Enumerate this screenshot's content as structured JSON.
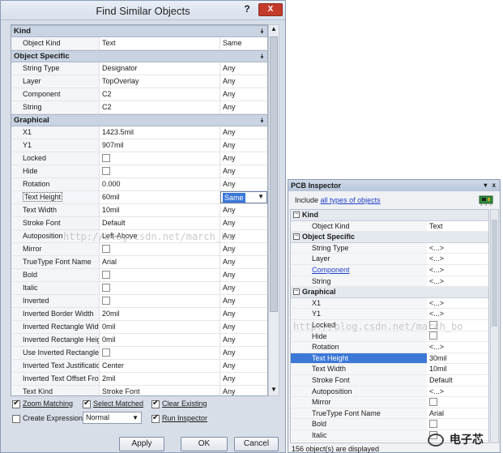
{
  "dialog": {
    "title": "Find Similar Objects",
    "help_glyph": "?",
    "close_glyph": "X",
    "categories": {
      "kind": "Kind",
      "object_specific": "Object Specific",
      "graphical": "Graphical"
    },
    "kind_rows": [
      {
        "label": "Object Kind",
        "value": "Text",
        "match": "Same"
      }
    ],
    "object_rows": [
      {
        "label": "String Type",
        "value": "Designator",
        "match": "Any"
      },
      {
        "label": "Layer",
        "value": "TopOverlay",
        "match": "Any"
      },
      {
        "label": "Component",
        "value": "C2",
        "match": "Any"
      },
      {
        "label": "String",
        "value": "C2",
        "match": "Any"
      }
    ],
    "graphical_rows": [
      {
        "label": "X1",
        "value": "1423.5mil",
        "match": "Any"
      },
      {
        "label": "Y1",
        "value": "907mil",
        "match": "Any"
      },
      {
        "label": "Locked",
        "value": "",
        "match": "Any",
        "checkbox": true
      },
      {
        "label": "Hide",
        "value": "",
        "match": "Any",
        "checkbox": true
      },
      {
        "label": "Rotation",
        "value": "0.000",
        "match": "Any"
      },
      {
        "label": "Text Height",
        "value": "60mil",
        "match": "Same",
        "selected": true
      },
      {
        "label": "Text Width",
        "value": "10mil",
        "match": "Any"
      },
      {
        "label": "Stroke Font",
        "value": "Default",
        "match": "Any"
      },
      {
        "label": "Autoposition",
        "value": "Left-Above",
        "match": "Any"
      },
      {
        "label": "Mirror",
        "value": "",
        "match": "Any",
        "checkbox": true
      },
      {
        "label": "TrueType Font Name",
        "value": "Arial",
        "match": "Any"
      },
      {
        "label": "Bold",
        "value": "",
        "match": "Any",
        "checkbox": true
      },
      {
        "label": "Italic",
        "value": "",
        "match": "Any",
        "checkbox": true
      },
      {
        "label": "Inverted",
        "value": "",
        "match": "Any",
        "checkbox": true
      },
      {
        "label": "Inverted Border Width",
        "value": "20mil",
        "match": "Any"
      },
      {
        "label": "Inverted Rectangle Widt",
        "value": "0mil",
        "match": "Any"
      },
      {
        "label": "Inverted Rectangle Heig",
        "value": "0mil",
        "match": "Any"
      },
      {
        "label": "Use Inverted Rectangle",
        "value": "",
        "match": "Any",
        "checkbox": true
      },
      {
        "label": "Inverted Text Justificatio",
        "value": "Center",
        "match": "Any"
      },
      {
        "label": "Inverted Text Offset Fror",
        "value": "2mil",
        "match": "Any"
      },
      {
        "label": "Text Kind",
        "value": "Stroke Font",
        "match": "Any"
      }
    ],
    "options": {
      "zoom_matching": {
        "label": "Zoom Matching",
        "checked": true
      },
      "select_matched": {
        "label": "Select Matched",
        "checked": true
      },
      "clear_existing": {
        "label": "Clear Existing",
        "checked": true
      },
      "create_expression": {
        "label": "Create Expression",
        "checked": false
      },
      "mode_value": "Normal",
      "run_inspector": {
        "label": "Run Inspector",
        "checked": true
      }
    },
    "buttons": {
      "apply": "Apply",
      "ok": "OK",
      "cancel": "Cancel"
    }
  },
  "inspector": {
    "title": "PCB Inspector",
    "header_controls": "▾ x",
    "include_prefix": "Include",
    "include_link": "all types of objects",
    "categories": {
      "kind": "Kind",
      "object_specific": "Object Specific",
      "graphical": "Graphical"
    },
    "kind_rows": [
      {
        "label": "Object Kind",
        "value": "Text"
      }
    ],
    "object_rows": [
      {
        "label": "String Type",
        "value": "<...>"
      },
      {
        "label": "Layer",
        "value": "<...>"
      },
      {
        "label": "Component",
        "value": "<...>",
        "link": true
      },
      {
        "label": "String",
        "value": "<...>"
      }
    ],
    "graphical_rows": [
      {
        "label": "X1",
        "value": "<...>"
      },
      {
        "label": "Y1",
        "value": "<...>"
      },
      {
        "label": "Locked",
        "value": "",
        "checkbox": true
      },
      {
        "label": "Hide",
        "value": "",
        "checkbox": true
      },
      {
        "label": "Rotation",
        "value": "<...>"
      },
      {
        "label": "Text Height",
        "value": "30mil",
        "highlighted": true
      },
      {
        "label": "Text Width",
        "value": "10mil"
      },
      {
        "label": "Stroke Font",
        "value": "Default"
      },
      {
        "label": "Autoposition",
        "value": "<...>"
      },
      {
        "label": "Mirror",
        "value": "",
        "checkbox": true
      },
      {
        "label": "TrueType Font Name",
        "value": "Arial"
      },
      {
        "label": "Bold",
        "value": "",
        "checkbox": true
      },
      {
        "label": "Italic",
        "value": "",
        "checkbox": true
      }
    ],
    "status": "156 object(s) are displayed"
  },
  "watermarks": {
    "left": "http://blog.csdn.net/march_bo",
    "right": "http://blog.csdn.net/march_bo"
  },
  "brand": "电子芯"
}
